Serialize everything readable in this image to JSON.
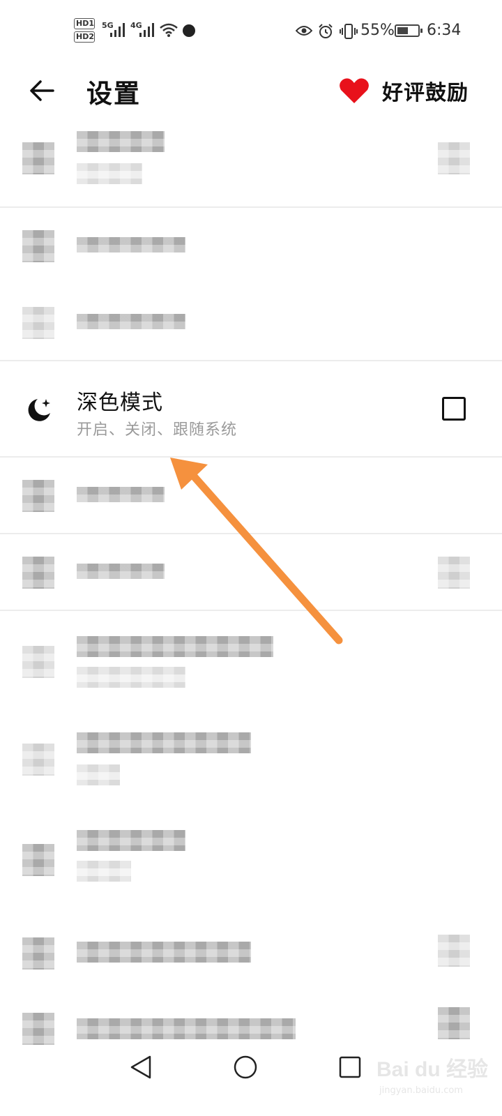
{
  "status_bar": {
    "hd1": "HD1",
    "hd2": "HD2",
    "net1": "5G",
    "net2": "4G",
    "battery_percent_text": "55%",
    "battery_level": 0.55,
    "time": "6:34",
    "icons": [
      "signal-icon",
      "wifi-icon",
      "eye-icon",
      "alarm-icon",
      "vibrate-icon",
      "battery-icon"
    ]
  },
  "app_bar": {
    "title": "设置",
    "rate_label": "好评鼓励",
    "heart_color": "#e8111b"
  },
  "dark_mode": {
    "title": "深色模式",
    "subtitle": "开启、关闭、跟随系统",
    "checked": false
  },
  "annotation": {
    "arrow_color": "#f5913e"
  },
  "watermark": {
    "brand": "Bai du 经验",
    "url": "jingyan.baidu.com"
  }
}
